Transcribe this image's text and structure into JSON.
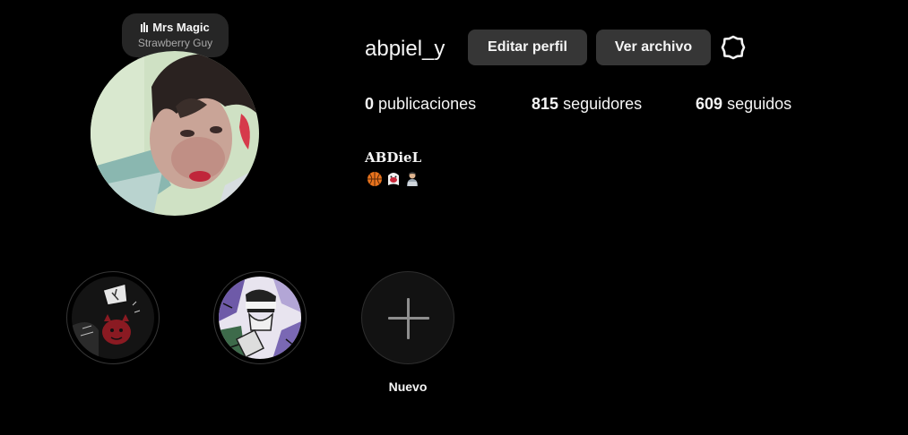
{
  "note": {
    "song_title": "Mrs Magic",
    "artist": "Strawberry Guy",
    "icon": "music-bars-icon"
  },
  "profile": {
    "username": "abpiel_y",
    "display_name": "ABDieL",
    "bio_emojis": [
      "basketball-icon",
      "ghost-face-icon",
      "technologist-icon"
    ]
  },
  "actions": {
    "edit_label": "Editar perfil",
    "archive_label": "Ver archivo",
    "settings_icon": "gear-icon"
  },
  "stats": {
    "posts_count": "0",
    "posts_label": "publicaciones",
    "followers_count": "815",
    "followers_label": "seguidores",
    "following_count": "609",
    "following_label": "seguidos"
  },
  "highlights": {
    "new_label": "Nuevo"
  },
  "colors": {
    "background": "#000000",
    "button": "#363636",
    "note_bubble": "#262626",
    "text": "#f5f5f5",
    "muted_text": "#a8a8a8"
  }
}
